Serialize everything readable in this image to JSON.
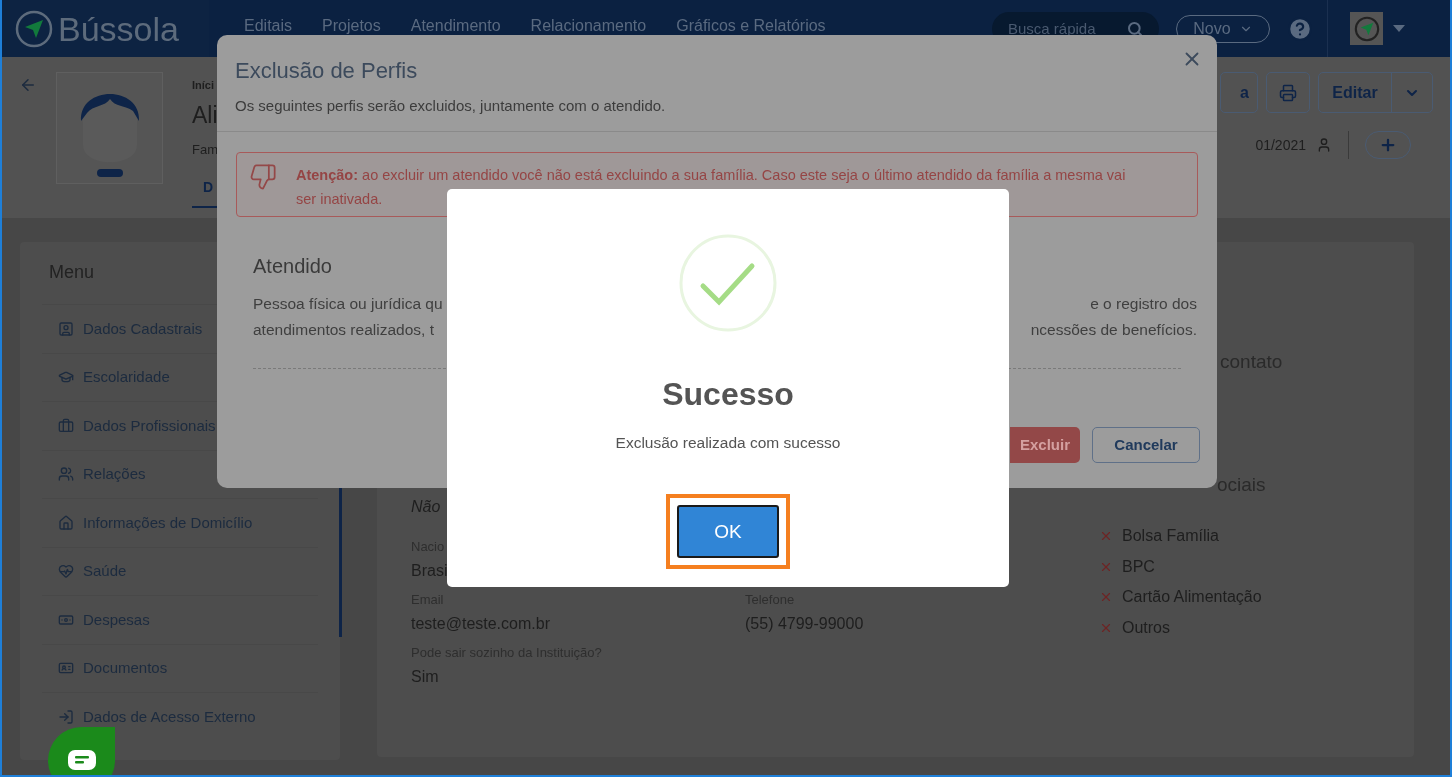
{
  "topbar": {
    "logo": "Bússola",
    "nav": [
      "Editais",
      "Projetos",
      "Atendimento",
      "Relacionamento",
      "Gráficos e Relatórios"
    ],
    "search": {
      "placeholder": "Busca rápida"
    },
    "new_button": "Novo"
  },
  "profile": {
    "breadcrumb": "Iníci",
    "name": "Ali",
    "family": "Fam",
    "tab": {
      "label": "D",
      "selected": true
    },
    "cut_button": "a",
    "edit_button": "Editar",
    "date": "01/2021"
  },
  "menu": {
    "title": "Menu",
    "items": [
      "Dados Cadastrais",
      "Escolaridade",
      "Dados Profissionais",
      "Relações",
      "Informações de Domicílio",
      "Saúde",
      "Despesas",
      "Documentos",
      "Dados de Acesso Externo"
    ]
  },
  "details": {
    "cut_value": "Não",
    "field_rows": [
      [
        {
          "label": "Nacio",
          "value": "Brasi"
        }
      ],
      [
        {
          "label": "Email",
          "value": "teste@teste.com.br"
        },
        {
          "label": "Telefone",
          "value": "(55) 4799-99000"
        }
      ],
      [
        {
          "label": "Pode sair sozinho da Instituição?",
          "value": "Sim"
        }
      ]
    ],
    "contact_heading": "contato",
    "benefits_heading": "ociais",
    "benefits": [
      {
        "label": "Bolsa Família",
        "checked": false
      },
      {
        "label": "BPC",
        "checked": false
      },
      {
        "label": "Cartão Alimentação",
        "checked": false
      },
      {
        "label": "Outros",
        "checked": false
      }
    ]
  },
  "delete_dialog": {
    "title": "Exclusão de Perfis",
    "subtitle": "Os seguintes perfis serão excluidos, juntamente com o atendido.",
    "alert_line_1": "**Atenção:** ao excluir um atendido você não está excluindo a sua família. Caso este seja o último atendido da família a mesma vai",
    "alert_line_2": "ser inativada.",
    "section_title": "Atendido",
    "text_left": [
      "Pessoa física ou jurídica qu",
      "atendimentos realizados, t"
    ],
    "text_right": [
      "e o registro dos",
      "ncessões de benefícios."
    ],
    "delete_button": "Excluir",
    "cancel_button": "Cancelar"
  },
  "success_dialog": {
    "title": "Sucesso",
    "message": "Exclusão realizada com sucesso",
    "ok_button": {
      "label": "OK",
      "focused": true
    }
  }
}
